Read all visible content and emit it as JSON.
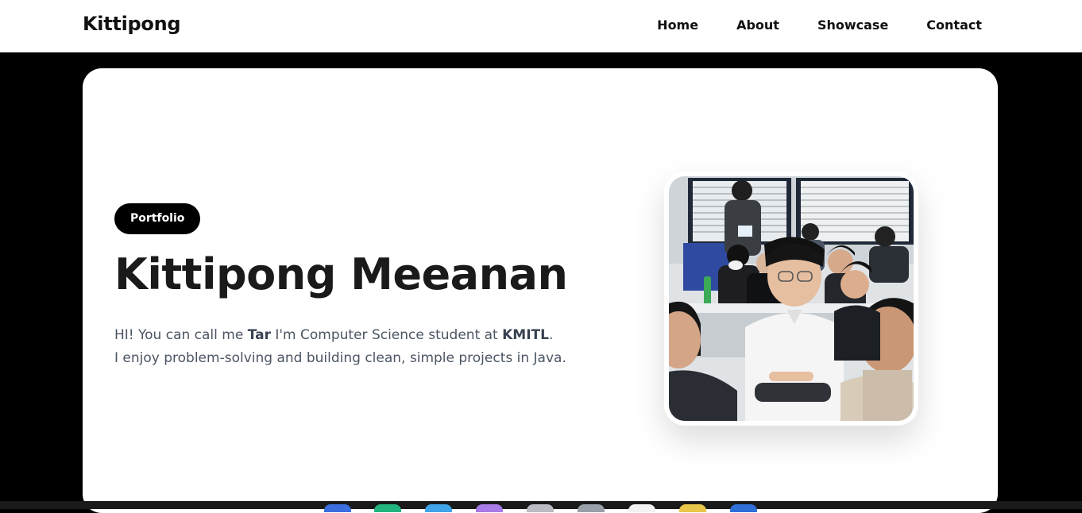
{
  "nav": {
    "brand": "Kittipong",
    "links": [
      {
        "label": "Home"
      },
      {
        "label": "About"
      },
      {
        "label": "Showcase"
      },
      {
        "label": "Contact"
      }
    ]
  },
  "hero": {
    "badge": "Portfolio",
    "title": "Kittipong Meeanan",
    "intro_prefix": "HI! You can call me ",
    "nickname": "Tar",
    "intro_middle": " I'm Computer Science student at ",
    "school": "KMITL",
    "intro_suffix": ".",
    "line2": "I enjoy problem-solving and building clean, simple projects in Java."
  },
  "colors": {
    "page_background": "#000000",
    "card_background": "#ffffff",
    "badge_background": "#000000",
    "title_color": "#1a1a1a",
    "body_text_color": "#4b5563"
  }
}
